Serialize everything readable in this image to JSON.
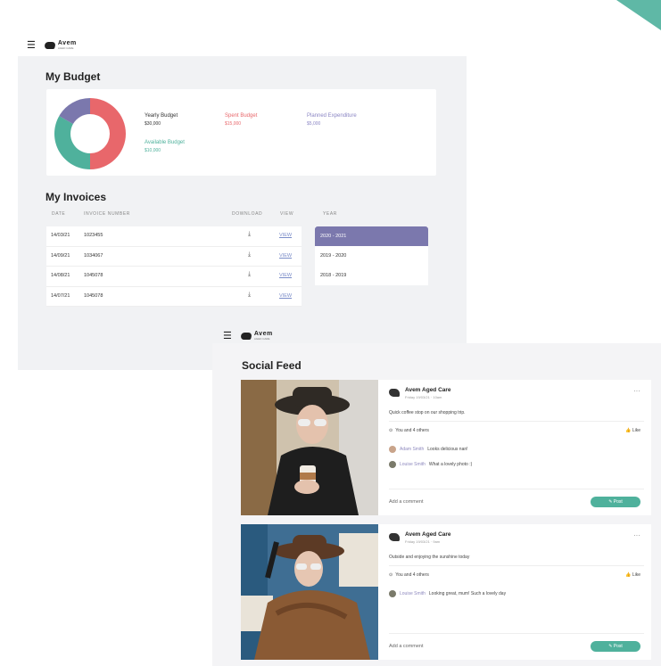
{
  "brand": {
    "name": "Avem",
    "tagline": "AGED CARE"
  },
  "budget_screen": {
    "title": "My Budget",
    "items": [
      {
        "label": "Yearly Budget",
        "value": "$30,000",
        "color": "#333333"
      },
      {
        "label": "Spent Budget",
        "value": "$15,000",
        "color": "#e8676b"
      },
      {
        "label": "Planned Expenditure",
        "value": "$5,000",
        "color": "#8b86c4"
      },
      {
        "label": "Available Budget",
        "value": "$10,000",
        "color": "#4fb19c"
      }
    ],
    "donut": [
      {
        "name": "Spent",
        "value": 50,
        "color": "#e8676b"
      },
      {
        "name": "Available",
        "value": 33.3,
        "color": "#4fb19c"
      },
      {
        "name": "Planned",
        "value": 16.7,
        "color": "#7b78ad"
      }
    ],
    "invoices_title": "My Invoices",
    "columns": {
      "date": "DATE",
      "number": "INVOICE NUMBER",
      "download": "DOWNLOAD",
      "view": "VIEW",
      "year": "YEAR"
    },
    "invoices": [
      {
        "date": "14/03/21",
        "number": "1023455",
        "view": "VIEW"
      },
      {
        "date": "14/09/21",
        "number": "1034067",
        "view": "VIEW"
      },
      {
        "date": "14/08/21",
        "number": "1045078",
        "view": "VIEW"
      },
      {
        "date": "14/07/21",
        "number": "1045078",
        "view": "VIEW"
      }
    ],
    "years": [
      "2020 - 2021",
      "2019 - 2020",
      "2018 - 2019"
    ],
    "active_year": "2020 - 2021"
  },
  "social_screen": {
    "title": "Social Feed",
    "posts": [
      {
        "org": "Avem Aged Care",
        "date": "Friday 19/03/21 · 10am",
        "text": "Quick coffee stop on our shopping trip.",
        "likes": "You and 4 others",
        "like_label": "Like",
        "comments": [
          {
            "name": "Adam Smith",
            "msg": "Looks delicious nan!"
          },
          {
            "name": "Louise Smith",
            "msg": "What a lovely photo :)"
          }
        ],
        "add_comment": "Add a comment",
        "post_label": "Post"
      },
      {
        "org": "Avem Aged Care",
        "date": "Friday 19/03/21 · 9am",
        "text": "Outside and enjoying the sunshine today",
        "likes": "You and 4 others",
        "like_label": "Like",
        "comments": [
          {
            "name": "Louise Smith",
            "msg": "Looking great, mum! Such a lovely day"
          }
        ],
        "add_comment": "Add a comment",
        "post_label": "Post"
      }
    ]
  }
}
